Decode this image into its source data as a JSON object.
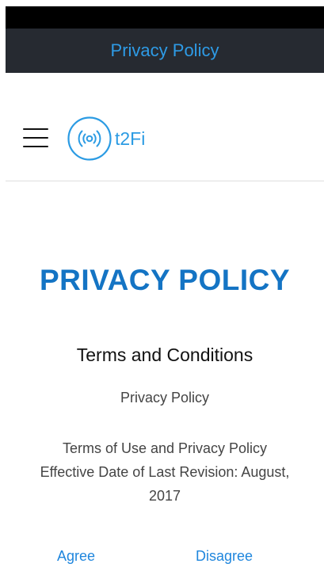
{
  "nav": {
    "title": "Privacy Policy"
  },
  "header": {
    "menu_icon": "hamburger-menu-icon",
    "logo_icon": "wifi-signal-icon",
    "logo_text": "t2Fi",
    "brand_color": "#2b9be3"
  },
  "content": {
    "heading": "PRIVACY POLICY",
    "subheading": "Terms and Conditions",
    "privacy_label": "Privacy Policy",
    "terms_line1": "Terms of Use and Privacy Policy",
    "terms_line2": "Effective Date of Last Revision: August, 2017"
  },
  "actions": {
    "agree": "Agree",
    "disagree": "Disagree",
    "link_color": "#1f86dd"
  }
}
